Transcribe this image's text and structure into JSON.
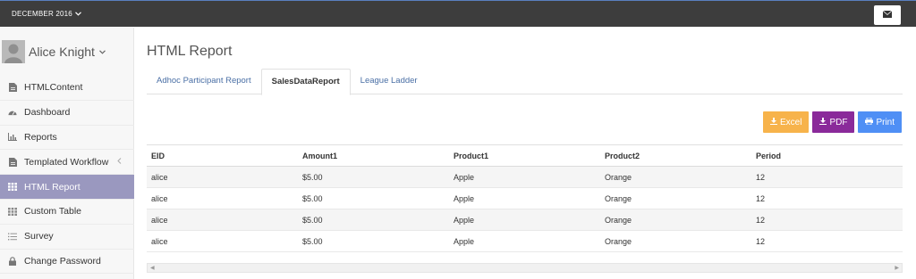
{
  "header": {
    "period_label": "DECEMBER 2016",
    "period_icon": "chevron-down-icon",
    "mail_icon": "envelope-icon"
  },
  "user": {
    "name": "Alice Knight",
    "avatar_icon": "user-silhouette-icon"
  },
  "sidebar": {
    "items": [
      {
        "label": "HTMLContent",
        "icon": "file-icon"
      },
      {
        "label": "Dashboard",
        "icon": "dashboard-icon"
      },
      {
        "label": "Reports",
        "icon": "bar-chart-icon"
      },
      {
        "label": "Templated Workflow",
        "icon": "file-icon"
      },
      {
        "label": "HTML Report",
        "icon": "grid-icon"
      },
      {
        "label": "Custom Table",
        "icon": "table-icon"
      },
      {
        "label": "Survey",
        "icon": "list-icon"
      },
      {
        "label": "Change Password",
        "icon": "lock-icon"
      }
    ],
    "active_index": 4
  },
  "main": {
    "title": "HTML Report",
    "tabs": [
      "Adhoc Participant Report",
      "SalesDataReport",
      "League Ladder"
    ],
    "active_tab": 1,
    "buttons": {
      "excel": "Excel",
      "pdf": "PDF",
      "print": "Print"
    },
    "table": {
      "columns": [
        "EID",
        "Amount1",
        "Product1",
        "Product2",
        "Period"
      ],
      "rows": [
        [
          "alice",
          "$5.00",
          "Apple",
          "Orange",
          "12"
        ],
        [
          "alice",
          "$5.00",
          "Apple",
          "Orange",
          "12"
        ],
        [
          "alice",
          "$5.00",
          "Apple",
          "Orange",
          "12"
        ],
        [
          "alice",
          "$5.00",
          "Apple",
          "Orange",
          "12"
        ]
      ]
    }
  },
  "colors": {
    "topbar": "#3d3d3d",
    "active_menu": "#9a98bf",
    "excel": "#f7b34b",
    "pdf": "#8a2a9a",
    "print": "#4f8ff5",
    "tab_link": "#4a6fa5"
  }
}
